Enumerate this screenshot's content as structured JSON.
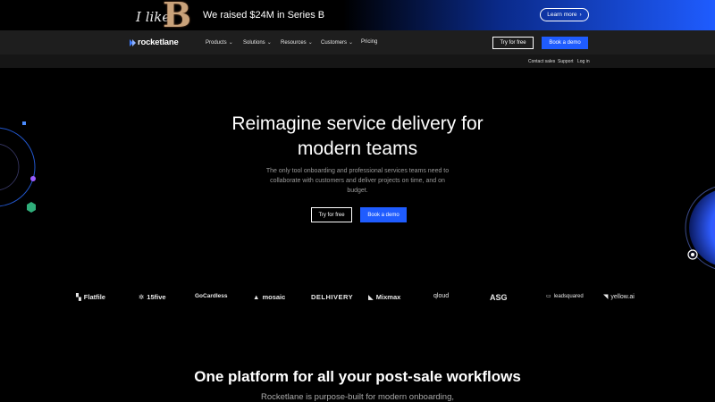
{
  "banner": {
    "art_text_italic": "I like",
    "art_text_letter": "B",
    "message": "We raised $24M in Series B",
    "learn_more": "Learn more",
    "learn_more_icon": "chevron-right-icon"
  },
  "nav": {
    "logo_text": "rocketlane",
    "items": [
      {
        "label": "Products",
        "dropdown": true
      },
      {
        "label": "Solutions",
        "dropdown": true
      },
      {
        "label": "Resources",
        "dropdown": true
      },
      {
        "label": "Customers",
        "dropdown": true
      },
      {
        "label": "Pricing",
        "dropdown": false
      }
    ],
    "try_free": "Try for free",
    "book_demo": "Book a demo"
  },
  "subnav": {
    "contact_sales": "Contact sales",
    "support": "Support",
    "login": "Log in"
  },
  "hero": {
    "title_line1": "Reimagine service delivery for",
    "title_line2": "modern teams",
    "subtitle": "The only tool onboarding and professional services teams need to collaborate with customers and deliver projects on time, and on budget.",
    "try_free": "Try for free",
    "book_demo": "Book a demo"
  },
  "customer_logos": [
    {
      "name": "Flatfile",
      "icon": "flatfile-icon"
    },
    {
      "name": "15five",
      "icon": "15five-icon"
    },
    {
      "name": "GoCardless",
      "icon": ""
    },
    {
      "name": "mosaic",
      "icon": "mosaic-icon"
    },
    {
      "name": "DELHIVERY",
      "icon": ""
    },
    {
      "name": "Mixmax",
      "icon": "mixmax-icon"
    },
    {
      "name": "qloud",
      "icon": ""
    },
    {
      "name": "ASG",
      "icon": ""
    },
    {
      "name": "leadsquared",
      "icon": "leadsquared-icon"
    },
    {
      "name": "yellow.ai",
      "icon": "yellow-ai-icon"
    }
  ],
  "section": {
    "title": "One platform for all your post-sale workflows",
    "subtitle": "Rocketlane is purpose-built for modern onboarding,"
  },
  "colors": {
    "accent": "#1f5cff",
    "nav_bg": "#1e1e1e",
    "page_bg": "#000000"
  }
}
